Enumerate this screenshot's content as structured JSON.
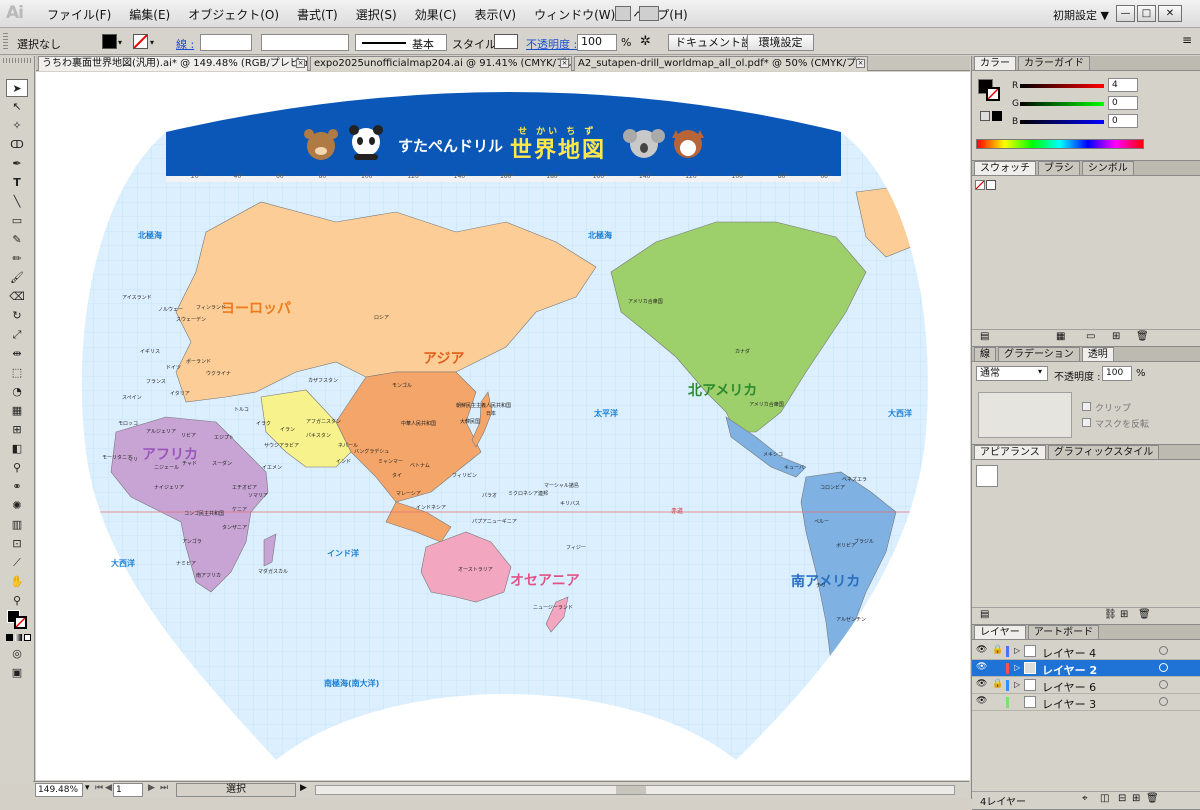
{
  "app": {
    "logo": "Ai",
    "workspace": "初期設定 ▼"
  },
  "menu": [
    "ファイル(F)",
    "編集(E)",
    "オブジェクト(O)",
    "書式(T)",
    "選択(S)",
    "効果(C)",
    "表示(V)",
    "ウィンドウ(W)",
    "ヘルプ(H)"
  ],
  "control": {
    "selection": "選択なし",
    "stroke_label": "線 :",
    "stroke_profile": "基本",
    "style_label": "スタイル :",
    "opacity_label": "不透明度 :",
    "opacity_value": "100",
    "opacity_unit": "%",
    "doc_settings": "ドキュメント設定",
    "prefs": "環境設定"
  },
  "tabs": [
    {
      "label": "うちわ裏面世界地図(汎用).ai* @ 149.48% (RGB/プレビュー)",
      "active": true
    },
    {
      "label": "expo2025unofficialmap204.ai @ 91.41% (CMYK/プレビュー)",
      "active": false
    },
    {
      "label": "A2_sutapen-drill_worldmap_all_ol.pdf* @ 50% (CMYK/プレビュー)",
      "active": false
    }
  ],
  "map": {
    "banner_title": "すたぺんドリル",
    "banner_highlight": "世界地図",
    "banner_ruby": "せ  かい  ち  ず",
    "continents": {
      "europe": "ヨーロッパ",
      "asia": "アジア",
      "africa": "アフリカ",
      "oceania": "オセアニア",
      "north_america": "北アメリカ",
      "south_america": "南アメリカ"
    },
    "oceans": {
      "arctic_w": "北極海",
      "arctic_e": "北極海",
      "pacific": "太平洋",
      "atlantic_e": "大西洋",
      "atlantic_w": "大西洋",
      "indian": "インド洋",
      "southern": "南極海(南大洋)",
      "equator": "赤道"
    },
    "countries": {
      "russia": "ロシア",
      "mongolia": "モンゴル",
      "china": "中華人民共和国",
      "india": "インド",
      "japan": "日本",
      "australia": "オーストラリア",
      "new_zealand": "ニュージーランド",
      "canada": "カナダ",
      "usa": "アメリカ合衆国",
      "alaska": "アメリカ合衆国",
      "mexico": "メキシコ",
      "brazil": "ブラジル",
      "argentina": "アルゼンチン",
      "peru": "ペルー",
      "kazakhstan": "カザフスタン",
      "iran": "イラン",
      "saudi": "サウジアラビア",
      "egypt": "エジプト",
      "algeria": "アルジェリア",
      "libya": "リビア",
      "sudan": "スーダン",
      "congo": "コンゴ民主共和国",
      "madagascar": "マダガスカル",
      "indonesia": "インドネシア",
      "philippines": "フィリピン",
      "png": "パプアニューギニア",
      "turkey": "トルコ",
      "mali": "マリ",
      "niger": "ニジェール",
      "chad": "チャド",
      "nigeria": "ナイジェリア",
      "ethiopia": "エチオピア",
      "kenya": "ケニア",
      "tanzania": "タンザニア",
      "angola": "アンゴラ",
      "south_africa": "南アフリカ",
      "namibia": "ナミビア",
      "mauritania": "モーリタニア",
      "cuba": "キューバ",
      "colombia": "コロンビア",
      "venezuela": "ベネズエラ",
      "bolivia": "ボリビア",
      "chile": "チリ",
      "thailand": "タイ",
      "vietnam": "ベトナム",
      "myanmar": "ミャンマー",
      "pakistan": "パキスタン",
      "afghanistan": "アフガニスタン",
      "ukraine": "ウクライナ",
      "uk": "イギリス",
      "france": "フランス",
      "spain": "スペイン",
      "germany": "ドイツ",
      "poland": "ポーランド",
      "sweden": "スウェーデン",
      "norway": "ノルウェー",
      "finland": "フィンランド",
      "iceland": "アイスランド",
      "italy": "イタリア",
      "iraq": "イラク",
      "yemen": "イエメン",
      "somalia": "ソマリア",
      "morocco": "モロッコ",
      "korea": "大韓民国",
      "nkorea": "朝鮮民主主義人民共和国",
      "bangladesh": "バングラデシュ",
      "nepal": "ネパール",
      "malaysia": "マレーシア",
      "marshall": "マーシャル諸島",
      "kiribati": "キリバス",
      "fiji": "フィジー",
      "micronesia": "ミクロネシア連邦",
      "palau": "パラオ"
    },
    "longitudes": [
      "20°",
      "40°",
      "60°",
      "80°",
      "100°",
      "120°",
      "140°",
      "160°",
      "180°",
      "160°",
      "140°",
      "120°",
      "100°",
      "80°",
      "60°"
    ]
  },
  "status": {
    "zoom": "149.48%",
    "page": "1",
    "mode": "選択"
  },
  "panels": {
    "color_tabs": [
      "カラー",
      "カラーガイド"
    ],
    "rgb": [
      {
        "label": "R",
        "value": "4",
        "color": "#d40000"
      },
      {
        "label": "G",
        "value": "0",
        "color": "#00a000"
      },
      {
        "label": "B",
        "value": "0",
        "color": "#0000d0"
      }
    ],
    "swatch_tabs": [
      "スウォッチ",
      "ブラシ",
      "シンボル"
    ],
    "trans_tabs": [
      "線",
      "グラデーション",
      "透明"
    ],
    "blend_mode": "通常",
    "opacity_label": "不透明度 :",
    "opacity_value": "100",
    "opacity_unit": "%",
    "clip": "クリップ",
    "invert": "マスクを反転",
    "appearance_tabs": [
      "アピアランス",
      "グラフィックスタイル"
    ],
    "layer_tabs": [
      "レイヤー",
      "アートボード"
    ],
    "layers": [
      {
        "name": "レイヤー 4",
        "color": "#4f6fff",
        "locked": true,
        "selected": false
      },
      {
        "name": "レイヤー 2",
        "color": "#ff4f4f",
        "locked": false,
        "selected": true
      },
      {
        "name": "レイヤー 6",
        "color": "#2f8fff",
        "locked": true,
        "selected": false
      },
      {
        "name": "レイヤー 3",
        "color": "#7fe070",
        "locked": false,
        "selected": false
      }
    ],
    "layer_count": "4レイヤー"
  }
}
